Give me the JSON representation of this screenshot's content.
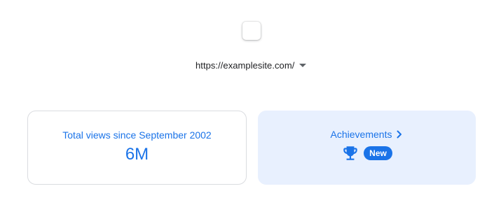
{
  "property": {
    "url": "https://examplesite.com/"
  },
  "stats": {
    "views_label": "Total views since September 2002",
    "views_value": "6M"
  },
  "achievements": {
    "title": "Achievements",
    "badge": "New",
    "icon": "trophy-icon"
  },
  "colors": {
    "accent": "#1a73e8",
    "achievements_bg": "#e8f0fe",
    "card_border": "#dadce0"
  }
}
